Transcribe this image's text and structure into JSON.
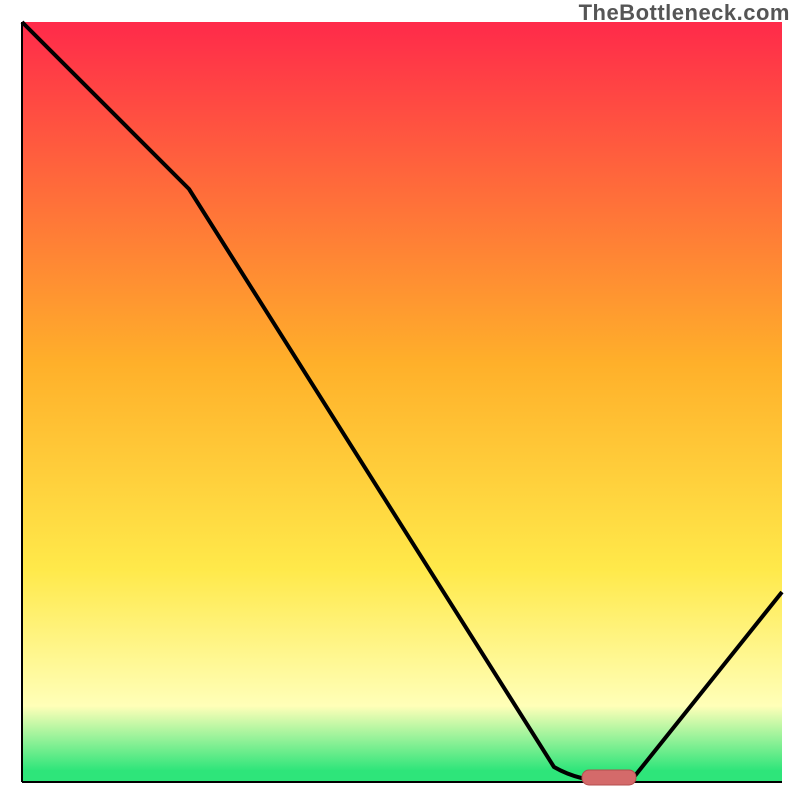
{
  "attribution": "TheBottleneck.com",
  "colors": {
    "gradient_top": "#ff2a4a",
    "gradient_mid": "#ffb02a",
    "gradient_yellow": "#ffe94a",
    "gradient_pale": "#ffffb8",
    "gradient_green": "#2ee57a",
    "curve": "#000000",
    "marker_fill": "#d46a6a",
    "marker_stroke": "#b34e4e",
    "axis": "#000000"
  },
  "chart_data": {
    "type": "line",
    "title": "",
    "xlabel": "",
    "ylabel": "",
    "xlim": [
      0,
      100
    ],
    "ylim": [
      0,
      100
    ],
    "series": [
      {
        "name": "bottleneck-curve",
        "x": [
          0,
          22,
          70,
          78,
          80,
          100
        ],
        "y": [
          100,
          78,
          2,
          0,
          0,
          25
        ]
      }
    ],
    "marker": {
      "x": 77,
      "y": 0,
      "width": 6,
      "height": 2
    },
    "gradient_stops": [
      {
        "offset": 0.0,
        "color": "#ff2a4a"
      },
      {
        "offset": 0.45,
        "color": "#ffb02a"
      },
      {
        "offset": 0.72,
        "color": "#ffe94a"
      },
      {
        "offset": 0.9,
        "color": "#ffffb8"
      },
      {
        "offset": 0.985,
        "color": "#2ee57a"
      }
    ]
  }
}
